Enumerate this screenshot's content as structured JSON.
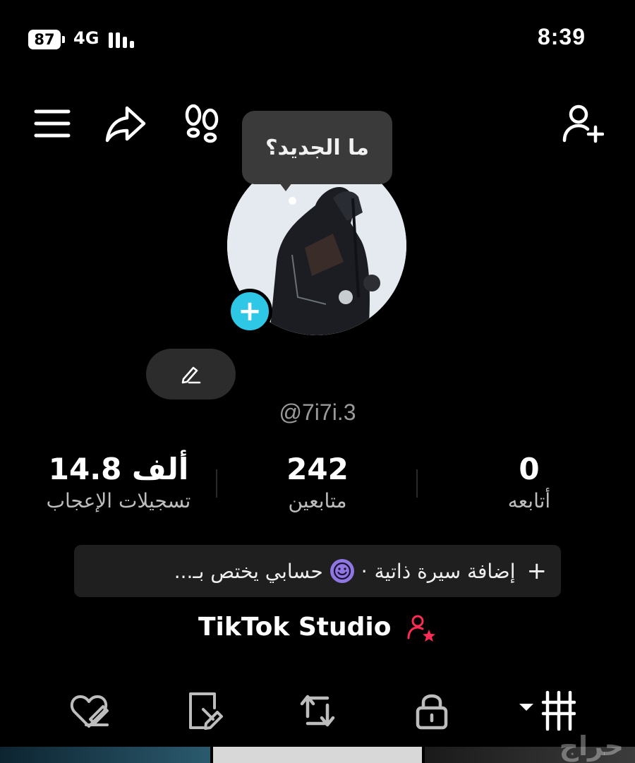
{
  "status_bar": {
    "battery": "87",
    "network": "4G",
    "time": "8:39"
  },
  "tooltip": {
    "text": "ما الجديد؟"
  },
  "profile": {
    "username": "@7i7i.3"
  },
  "stats": [
    {
      "value": "0",
      "label": "أتابعه"
    },
    {
      "value": "242",
      "label": "متابعين"
    },
    {
      "value": "14.8 ألف",
      "label": "تسجيلات الإعجاب"
    }
  ],
  "bio": {
    "add_label": "إضافة سيرة ذاتية",
    "separator": "·",
    "status_text": "حسابي يختص بـ..."
  },
  "studio": {
    "label": "TikTok Studio"
  },
  "watermark": {
    "text": "حراج"
  },
  "colors": {
    "accent_cyan": "#2ec7e6",
    "studio_pink": "#fe2c55",
    "smile_purple": "#8f76e0"
  },
  "icons": {
    "menu": "hamburger-icon",
    "share": "share-arrow-icon",
    "footprints": "footprints-icon",
    "add_friend": "add-user-icon",
    "edit": "pencil-icon",
    "tabs": [
      "grid-icon",
      "lock-icon",
      "repost-icon",
      "tagged-icon",
      "liked-icon"
    ]
  }
}
